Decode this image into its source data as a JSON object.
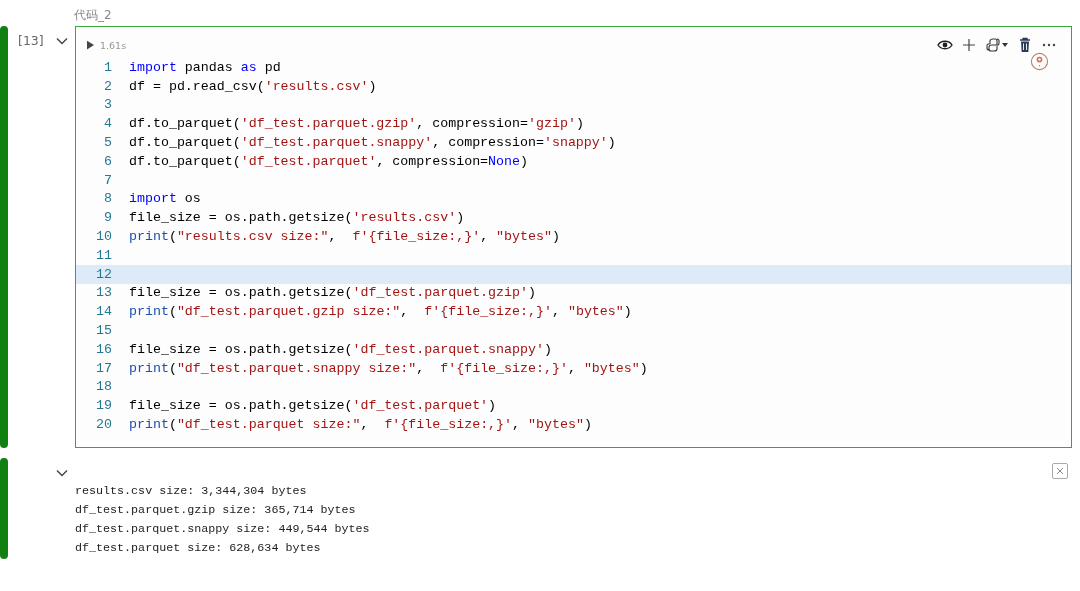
{
  "cell_label": "代码_2",
  "cell": {
    "prompt": "[13]",
    "collapsed": false,
    "duration": "1.61s",
    "lines": [
      {
        "number": "1",
        "current": false,
        "tokens": [
          {
            "kind": "keyword",
            "text": "import"
          },
          {
            "kind": "plain",
            "text": " pandas "
          },
          {
            "kind": "keyword",
            "text": "as"
          },
          {
            "kind": "plain",
            "text": " pd"
          }
        ]
      },
      {
        "number": "2",
        "current": false,
        "tokens": [
          {
            "kind": "plain",
            "text": "df = pd.read_csv("
          },
          {
            "kind": "string",
            "text": "'results.csv'"
          },
          {
            "kind": "plain",
            "text": ")"
          }
        ]
      },
      {
        "number": "3",
        "current": false
      },
      {
        "number": "4",
        "current": false,
        "tokens": [
          {
            "kind": "plain",
            "text": "df.to_parquet("
          },
          {
            "kind": "string",
            "text": "'df_test.parquet.gzip'"
          },
          {
            "kind": "plain",
            "text": ", compression="
          },
          {
            "kind": "string",
            "text": "'gzip'"
          },
          {
            "kind": "plain",
            "text": ")"
          }
        ]
      },
      {
        "number": "5",
        "current": false,
        "tokens": [
          {
            "kind": "plain",
            "text": "df.to_parquet("
          },
          {
            "kind": "string",
            "text": "'df_test.parquet.snappy'"
          },
          {
            "kind": "plain",
            "text": ", compression="
          },
          {
            "kind": "string",
            "text": "'snappy'"
          },
          {
            "kind": "plain",
            "text": ")"
          }
        ]
      },
      {
        "number": "6",
        "current": false,
        "tokens": [
          {
            "kind": "plain",
            "text": "df.to_parquet("
          },
          {
            "kind": "string",
            "text": "'df_test.parquet'"
          },
          {
            "kind": "plain",
            "text": ", compression="
          },
          {
            "kind": "keyword",
            "text": "None"
          },
          {
            "kind": "plain",
            "text": ")"
          }
        ]
      },
      {
        "number": "7",
        "current": false
      },
      {
        "number": "8",
        "current": false,
        "tokens": [
          {
            "kind": "keyword",
            "text": "import"
          },
          {
            "kind": "plain",
            "text": " os"
          }
        ]
      },
      {
        "number": "9",
        "current": false,
        "tokens": [
          {
            "kind": "plain",
            "text": "file_size = os.path.getsize("
          },
          {
            "kind": "string",
            "text": "'results.csv'"
          },
          {
            "kind": "plain",
            "text": ")"
          }
        ]
      },
      {
        "number": "10",
        "current": false,
        "tokens": [
          {
            "kind": "builtin",
            "text": "print"
          },
          {
            "kind": "plain",
            "text": "("
          },
          {
            "kind": "string",
            "text": "\"results.csv size:\""
          },
          {
            "kind": "plain",
            "text": ",  "
          },
          {
            "kind": "string",
            "text": "f'{file_size:,}'"
          },
          {
            "kind": "plain",
            "text": ", "
          },
          {
            "kind": "string",
            "text": "\"bytes\""
          },
          {
            "kind": "plain",
            "text": ")"
          }
        ]
      },
      {
        "number": "11",
        "current": false
      },
      {
        "number": "12",
        "current": true
      },
      {
        "number": "13",
        "current": false,
        "tokens": [
          {
            "kind": "plain",
            "text": "file_size = os.path.getsize("
          },
          {
            "kind": "string",
            "text": "'df_test.parquet.gzip'"
          },
          {
            "kind": "plain",
            "text": ")"
          }
        ]
      },
      {
        "number": "14",
        "current": false,
        "tokens": [
          {
            "kind": "builtin",
            "text": "print"
          },
          {
            "kind": "plain",
            "text": "("
          },
          {
            "kind": "string",
            "text": "\"df_test.parquet.gzip size:\""
          },
          {
            "kind": "plain",
            "text": ",  "
          },
          {
            "kind": "string",
            "text": "f'{file_size:,}'"
          },
          {
            "kind": "plain",
            "text": ", "
          },
          {
            "kind": "string",
            "text": "\"bytes\""
          },
          {
            "kind": "plain",
            "text": ")"
          }
        ]
      },
      {
        "number": "15",
        "current": false
      },
      {
        "number": "16",
        "current": false,
        "tokens": [
          {
            "kind": "plain",
            "text": "file_size = os.path.getsize("
          },
          {
            "kind": "string",
            "text": "'df_test.parquet.snappy'"
          },
          {
            "kind": "plain",
            "text": ")"
          }
        ]
      },
      {
        "number": "17",
        "current": false,
        "tokens": [
          {
            "kind": "builtin",
            "text": "print"
          },
          {
            "kind": "plain",
            "text": "("
          },
          {
            "kind": "string",
            "text": "\"df_test.parquet.snappy size:\""
          },
          {
            "kind": "plain",
            "text": ",  "
          },
          {
            "kind": "string",
            "text": "f'{file_size:,}'"
          },
          {
            "kind": "plain",
            "text": ", "
          },
          {
            "kind": "string",
            "text": "\"bytes\""
          },
          {
            "kind": "plain",
            "text": ")"
          }
        ]
      },
      {
        "number": "18",
        "current": false
      },
      {
        "number": "19",
        "current": false,
        "tokens": [
          {
            "kind": "plain",
            "text": "file_size = os.path.getsize("
          },
          {
            "kind": "string",
            "text": "'df_test.parquet'"
          },
          {
            "kind": "plain",
            "text": ")"
          }
        ]
      },
      {
        "number": "20",
        "current": false,
        "tokens": [
          {
            "kind": "builtin",
            "text": "print"
          },
          {
            "kind": "plain",
            "text": "("
          },
          {
            "kind": "string",
            "text": "\"df_test.parquet size:\""
          },
          {
            "kind": "plain",
            "text": ",  "
          },
          {
            "kind": "string",
            "text": "f'{file_size:,}'"
          },
          {
            "kind": "plain",
            "text": ", "
          },
          {
            "kind": "string",
            "text": "\"bytes\""
          },
          {
            "kind": "plain",
            "text": ")"
          }
        ]
      }
    ]
  },
  "output": {
    "collapsed": false,
    "lines": [
      "results.csv size: 3,344,304 bytes",
      "df_test.parquet.gzip size: 365,714 bytes",
      "df_test.parquet.snappy size: 449,544 bytes",
      "df_test.parquet size: 628,634 bytes"
    ]
  }
}
